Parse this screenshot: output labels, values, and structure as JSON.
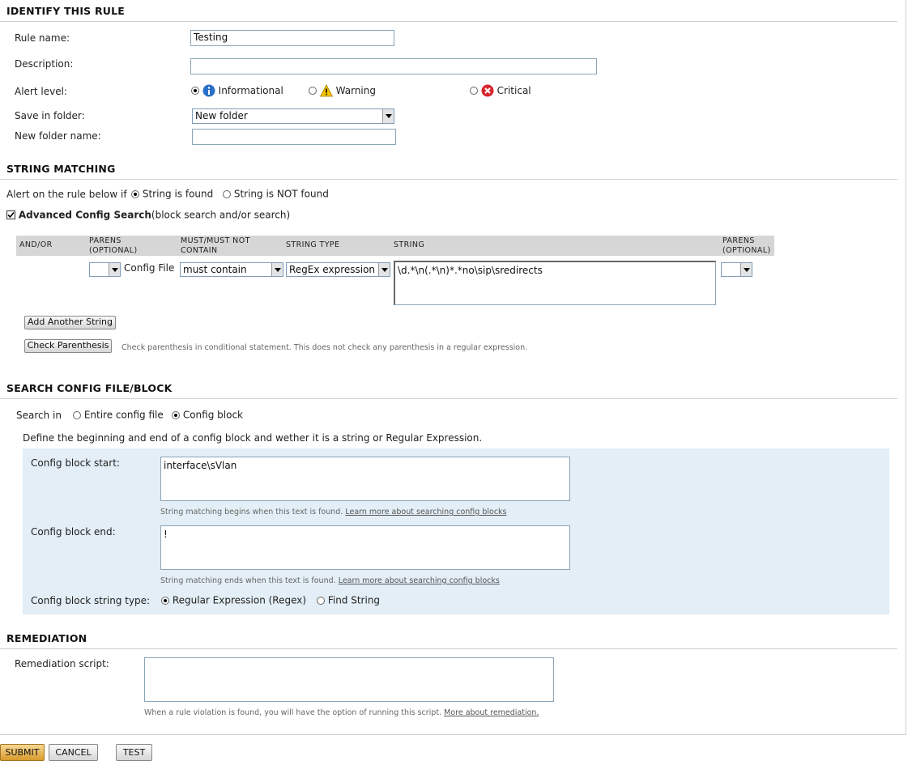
{
  "identify": {
    "title": "IDENTIFY THIS RULE",
    "rule_name_label": "Rule name:",
    "rule_name_value": "Testing",
    "description_label": "Description:",
    "description_value": "",
    "alert_level_label": "Alert level:",
    "alert_levels": [
      {
        "label": "Informational",
        "selected": true,
        "icon": "info-icon"
      },
      {
        "label": "Warning",
        "selected": false,
        "icon": "warning-icon"
      },
      {
        "label": "Critical",
        "selected": false,
        "icon": "critical-icon"
      }
    ],
    "save_folder_label": "Save in folder:",
    "save_folder_value": "New folder",
    "new_folder_label": "New folder name:",
    "new_folder_value": ""
  },
  "string_matching": {
    "title": "STRING MATCHING",
    "alert_prefix": "Alert on the rule below if",
    "found_label": "String is found",
    "not_found_label": "String is NOT found",
    "found_selected": true,
    "advanced_checked": true,
    "advanced_label": "Advanced Config Search",
    "advanced_suffix": "(block search and/or search)",
    "headers": {
      "and_or": "AND/OR",
      "parens_open_1": "PARENS",
      "parens_open_2": "(OPTIONAL)",
      "must_1": "MUST/MUST NOT",
      "must_2": "CONTAIN",
      "string_type": "STRING TYPE",
      "string": "STRING",
      "parens_close_1": "PARENS",
      "parens_close_2": "(OPTIONAL)"
    },
    "row": {
      "parens_open": "",
      "source": "Config File",
      "must": "must contain",
      "string_type": "RegEx expression",
      "string": "\\d.*\\n(.*\\n)*.*no\\sip\\sredirects",
      "parens_close": ""
    },
    "add_button": "Add Another String",
    "check_button": "Check Parenthesis",
    "check_hint": "Check parenthesis in conditional statement. This does not check any parenthesis in a regular expression."
  },
  "search_config": {
    "title": "SEARCH CONFIG FILE/BLOCK",
    "search_in_label": "Search in",
    "entire_label": "Entire config file",
    "block_label": "Config block",
    "block_selected": true,
    "define_text": "Define the beginning and end of a config block and wether it is a string or Regular Expression.",
    "start_label": "Config block start:",
    "start_value": "interface\\sVlan",
    "start_hint": "String matching begins when this text is found.",
    "end_label": "Config block end:",
    "end_value": "!",
    "end_hint": "String matching ends when this text is found.",
    "learn_more": "Learn more about searching config blocks",
    "type_label": "Config block string type:",
    "regex_label": "Regular Expression (Regex)",
    "find_label": "Find String",
    "regex_selected": true
  },
  "remediation": {
    "title": "REMEDIATION",
    "script_label": "Remediation script:",
    "script_value": "",
    "hint": "When a rule violation is found, you will have the option of running this script.",
    "more_link": "More about remediation."
  },
  "footer": {
    "submit": "SUBMIT",
    "cancel": "CANCEL",
    "test": "TEST"
  },
  "colors": {
    "panel": "#e3eef6",
    "header_band": "#d6d6d6",
    "submit": "#e8b04a"
  }
}
